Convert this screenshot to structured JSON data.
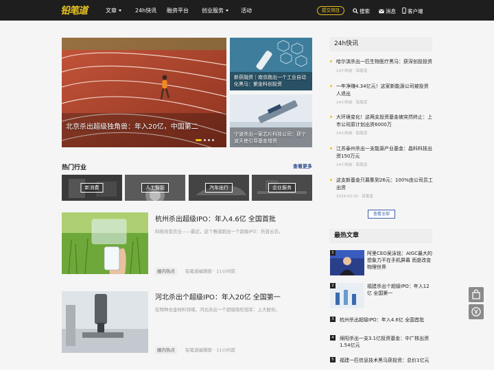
{
  "header": {
    "logo": "铅笔道",
    "nav": [
      {
        "label": "文章",
        "dropdown": true
      },
      {
        "label": "24h快讯",
        "dropdown": false
      },
      {
        "label": "融资平台",
        "dropdown": false
      },
      {
        "label": "创业服务",
        "dropdown": true
      },
      {
        "label": "活动",
        "dropdown": false
      }
    ],
    "submit_label": "提交项目",
    "search_label": "搜索",
    "message_label": "消息",
    "client_label": "客户端"
  },
  "hero": {
    "main_caption": "北京杀出超级独角兽：年入20亿，中国第二",
    "side": [
      "新获融资｜南京跑出一个工业自动化黑马：紫金科创投资",
      "宁波杀出一家芯片科技公司：获宁波天使引导基金增资"
    ]
  },
  "hot_industry": {
    "title": "热门行业",
    "more": "查看更多",
    "tiles": [
      "新消费",
      "人工智能",
      "汽车出行",
      "企业服务"
    ]
  },
  "articles": [
    {
      "title": "杭州杀出超级IPO：年入4.6亿 全国首批",
      "desc": "科技改变农业——最近，这个赛道跑出一个超级IPO：托普云农。",
      "tag": "圈内热点",
      "author": "铅笔道编辑部",
      "time": "11小时前"
    },
    {
      "title": "河北杀出个超级IPO：年入20亿 全国第一",
      "desc": "在特种合金材料领域，河北杀出一个超级隐形冠军：上大股份。",
      "tag": "圈内热点",
      "author": "铅笔道编辑部",
      "time": "11小时前"
    }
  ],
  "flash": {
    "title": "24h快讯",
    "items": [
      {
        "text": "哈尔滨杀出一匹生物医疗黑马：获深创投投资",
        "meta": "13小时前 · 铅笔道"
      },
      {
        "text": "一年净赚4.34亿元！这家新能源公司被投资人退出",
        "meta": "14小时前 · 铅笔道"
      },
      {
        "text": "大环境变化！这两支投资基金被突然终止：上市公司原计划出资6000万",
        "meta": "14小时前 · 铅笔道"
      },
      {
        "text": "江苏泰州杀出一支能源产业基金：晶科科技出资150万元",
        "meta": "14小时前 · 铅笔道"
      },
      {
        "text": "这支新基金只募集到26元：100%由公司员工出资",
        "meta": "2024-03-20 · 铅笔道"
      }
    ],
    "view_all": "查看全部"
  },
  "popular": {
    "title": "最热文章",
    "items": [
      {
        "num": "1",
        "text": "阿里CEO吴泳铭：AIGC最大的想象力不在手机屏幕 而是改变物理世界",
        "thumb": true
      },
      {
        "num": "2",
        "text": "福建杀出个超级IPO：年入12亿 全国第一",
        "thumb": true
      },
      {
        "num": "3",
        "text": "杭州杀出超级IPO：年入4.6亿 全国首批",
        "thumb": false
      },
      {
        "num": "4",
        "text": "绵阳杀出一支3.1亿投资基金：中广核出资1.54亿元",
        "thumb": false
      },
      {
        "num": "5",
        "text": "福建一匹信息技术黑马获投资：总价1亿元",
        "thumb": false
      }
    ]
  },
  "colors": {
    "accent": "#e8c31d",
    "header_bg": "#1e1e1e",
    "link": "#2a4b8d"
  }
}
